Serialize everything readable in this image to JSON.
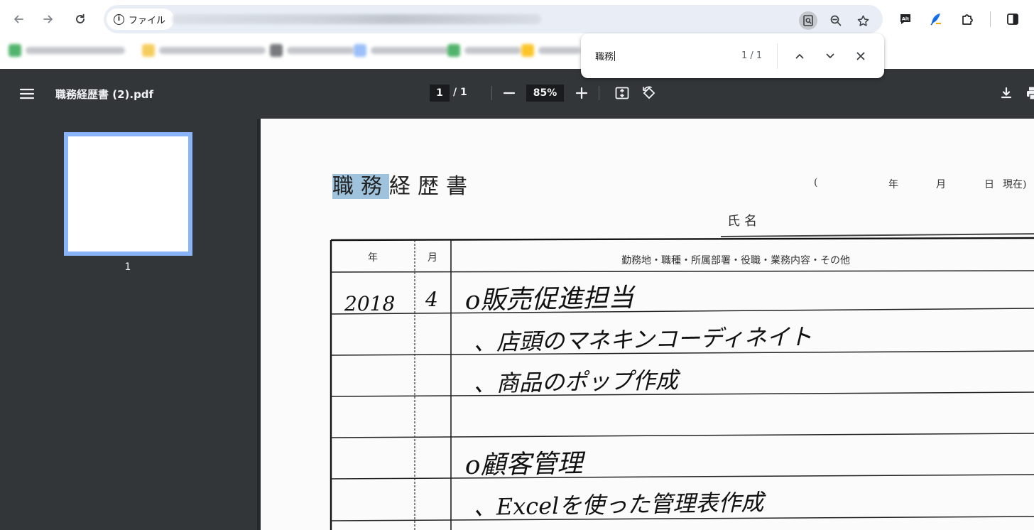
{
  "browser": {
    "site_chip_label": "ファイル",
    "bookmarks_count": 6
  },
  "find_bar": {
    "query": "職務",
    "count": "1 / 1"
  },
  "pdf_toolbar": {
    "title": "職務経歴書 (2).pdf",
    "current_page": "1",
    "page_total": "/ 1",
    "zoom": "85%"
  },
  "sidebar": {
    "thumbnail_label": "1"
  },
  "document": {
    "title_highlighted": "職務",
    "title_rest": "経歴書",
    "date_paren_open": "(",
    "date_year": "年",
    "date_month": "月",
    "date_day": "日",
    "date_current": "現在)",
    "name_label": "氏名",
    "table": {
      "col_year": "年",
      "col_month": "月",
      "col_details": "勤務地・職種・所属部署・役職・業務内容・その他",
      "rows": [
        {
          "year": "2018",
          "month": "4",
          "text": "o販売促進担当"
        },
        {
          "year": "",
          "month": "",
          "text": "、店頭のマネキンコーディネイト"
        },
        {
          "year": "",
          "month": "",
          "text": "、商品のポップ作成"
        },
        {
          "year": "",
          "month": "",
          "text": ""
        },
        {
          "year": "",
          "month": "",
          "text": "o顧客管理"
        },
        {
          "year": "",
          "month": "",
          "text": "、Excelを使った管理表作成"
        }
      ]
    }
  },
  "colors": {
    "pdf_toolbar_bg": "#323639",
    "thumb_border": "#8ab4f8",
    "search_highlight": "#9fc3dc",
    "omnibox_bg": "#e9eef6"
  }
}
